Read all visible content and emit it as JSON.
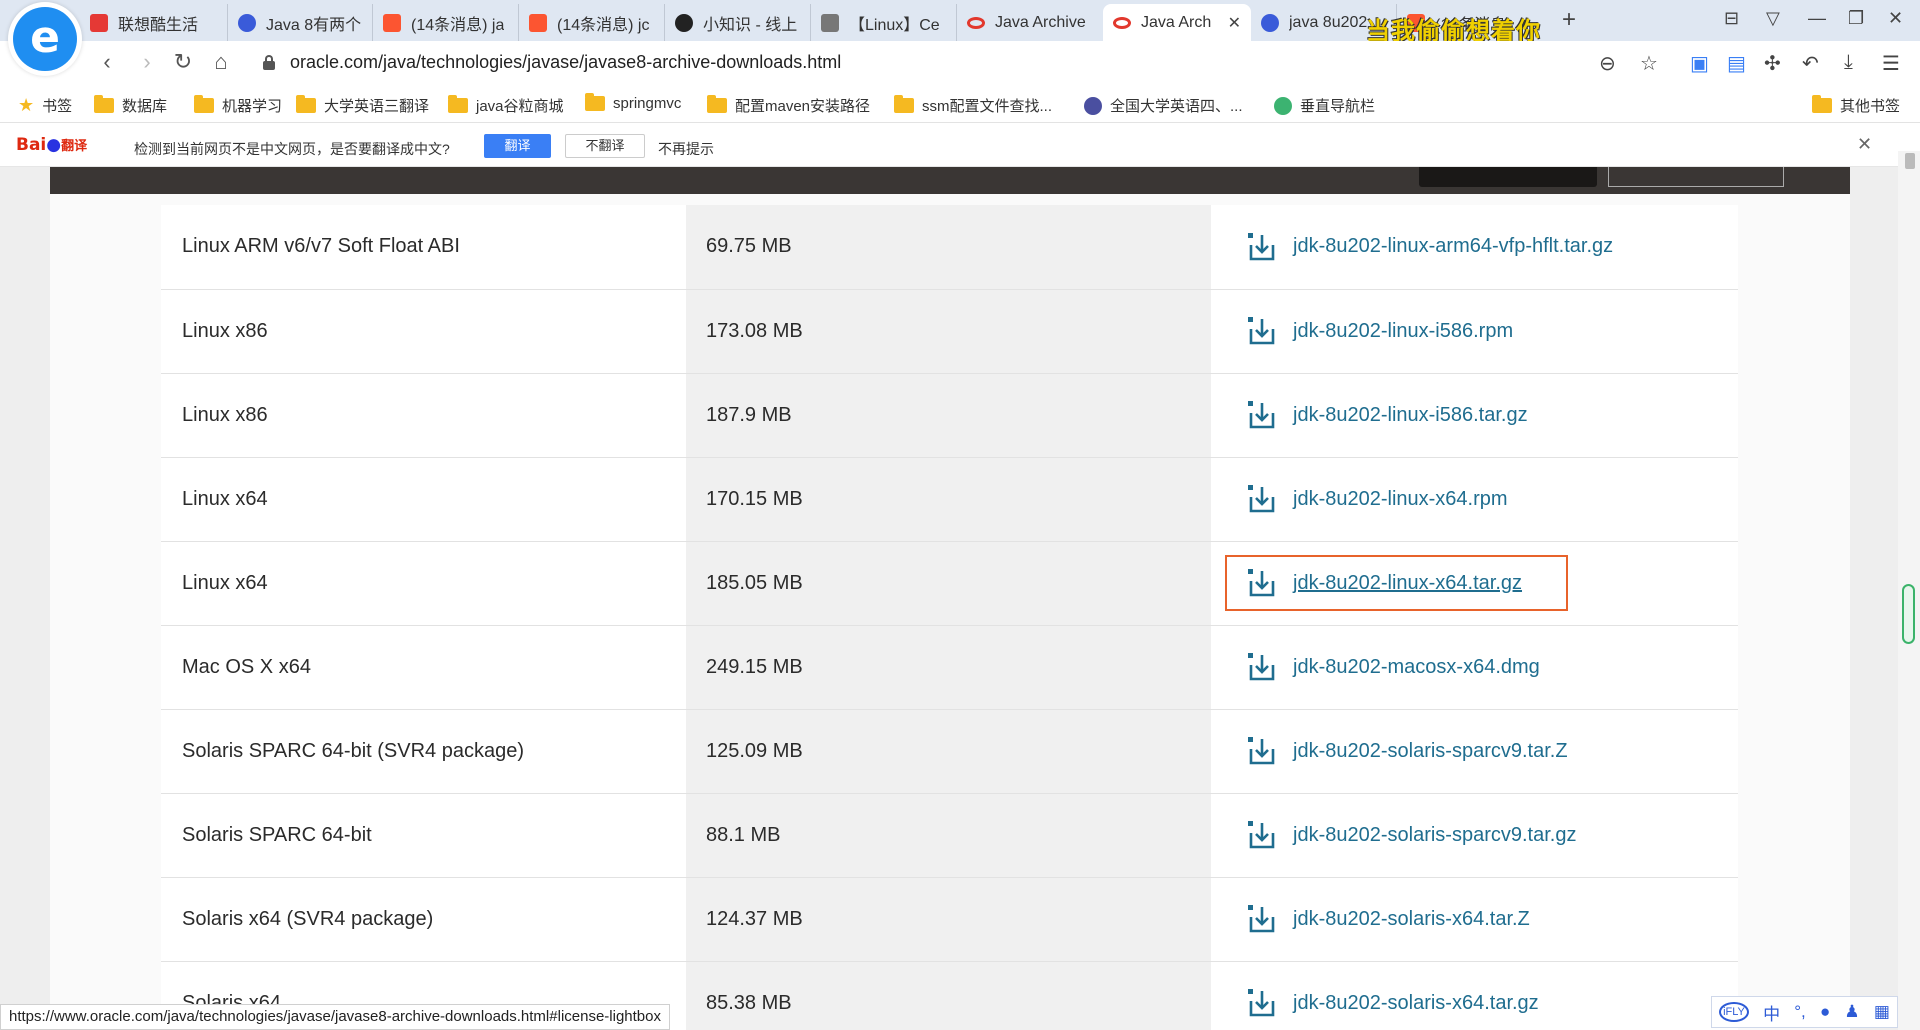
{
  "tabs": [
    {
      "label": "联想酷生活",
      "icon": "lenovo-icon"
    },
    {
      "label": "Java 8有两个",
      "icon": "baidu-paw-icon"
    },
    {
      "label": "(14条消息) ja",
      "icon": "csdn-icon"
    },
    {
      "label": "(14条消息) jc",
      "icon": "csdn-icon"
    },
    {
      "label": "小知识 - 线上",
      "icon": "money-bag-icon"
    },
    {
      "label": "【Linux】Ce",
      "icon": "linux-icon"
    },
    {
      "label": "Java Archive",
      "icon": "oracle-icon"
    },
    {
      "label": "Java Arch",
      "icon": "oracle-icon",
      "close": "✕"
    },
    {
      "label": "java 8u202",
      "icon": "baidu-paw-icon"
    },
    {
      "label": "(14条消息",
      "icon": "csdn-icon"
    }
  ],
  "banner_overlay": "当我偷偷想着你",
  "address": {
    "url": "oracle.com/java/technologies/javase/javase8-archive-downloads.html"
  },
  "bookmarks": {
    "star_label": "书签",
    "items": [
      "数据库",
      "机器学习",
      "大学英语三翻译",
      "java谷粒商城",
      "springmvc",
      "配置maven安装路径",
      "ssm配置文件查找...",
      "全国大学英语四、...",
      "垂直导航栏"
    ],
    "other": "其他书签"
  },
  "translate": {
    "logo_text": "Bai",
    "logo_sub": "翻译",
    "message": "检测到当前网页不是中文网页，是否要翻译成中文?",
    "translate_btn": "翻译",
    "no_translate_btn": "不翻译",
    "no_hint": "不再提示",
    "close": "✕"
  },
  "downloads": [
    {
      "product": "Linux ARM v6/v7 Soft Float ABI",
      "size": "69.75 MB",
      "file": "jdk-8u202-linux-arm64-vfp-hflt.tar.gz"
    },
    {
      "product": "Linux x86",
      "size": "173.08 MB",
      "file": "jdk-8u202-linux-i586.rpm"
    },
    {
      "product": "Linux x86",
      "size": "187.9 MB",
      "file": "jdk-8u202-linux-i586.tar.gz"
    },
    {
      "product": "Linux x64",
      "size": "170.15 MB",
      "file": "jdk-8u202-linux-x64.rpm"
    },
    {
      "product": "Linux x64",
      "size": "185.05 MB",
      "file": "jdk-8u202-linux-x64.tar.gz",
      "highlighted": true
    },
    {
      "product": "Mac OS X x64",
      "size": "249.15 MB",
      "file": "jdk-8u202-macosx-x64.dmg"
    },
    {
      "product": "Solaris SPARC 64-bit (SVR4 package)",
      "size": "125.09 MB",
      "file": "jdk-8u202-solaris-sparcv9.tar.Z"
    },
    {
      "product": "Solaris SPARC 64-bit",
      "size": "88.1 MB",
      "file": "jdk-8u202-solaris-sparcv9.tar.gz"
    },
    {
      "product": "Solaris x64 (SVR4 package)",
      "size": "124.37 MB",
      "file": "jdk-8u202-solaris-x64.tar.Z"
    },
    {
      "product": "Solaris x64",
      "size": "85.38 MB",
      "file": "jdk-8u202-solaris-x64.tar.gz"
    }
  ],
  "status_url": "https://www.oracle.com/java/technologies/javase/javase8-archive-downloads.html#license-lightbox",
  "ime": {
    "items": [
      "iFLY",
      "中",
      "°,",
      "mic",
      "user",
      "grid"
    ]
  },
  "colors": {
    "accent_link": "#1f6d8f",
    "highlight_border": "#e8632b",
    "oracle_header": "#3a3634"
  }
}
